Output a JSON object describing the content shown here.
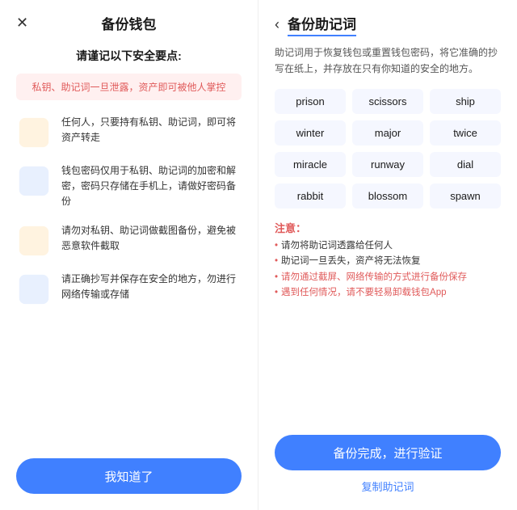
{
  "left": {
    "close_icon": "✕",
    "title": "备份钱包",
    "subtitle": "请谨记以下安全要点:",
    "warning": "私钥、助记词一旦泄露，资产即可被他人掌控",
    "tips": [
      {
        "text": "任何人，只要持有私钥、助记词，即可将资产转走"
      },
      {
        "text": "钱包密码仅用于私钥、助记词的加密和解密，密码只存储在手机上，请做好密码备份"
      },
      {
        "text": "请勿对私钥、助记词做截图备份，避免被恶意软件截取"
      },
      {
        "text": "请正确抄写并保存在安全的地方，勿进行网络传输或存储"
      }
    ],
    "button": "我知道了"
  },
  "right": {
    "back_icon": "‹",
    "title": "备份助记词",
    "description": "助记词用于恢复钱包或重置钱包密码，将它准确的抄写在纸上，并存放在只有你知道的安全的地方。",
    "words": [
      "prison",
      "scissors",
      "ship",
      "winter",
      "major",
      "twice",
      "miracle",
      "runway",
      "dial",
      "rabbit",
      "blossom",
      "spawn"
    ],
    "notice_title": "注意：",
    "notices": [
      {
        "text": "请勿将助记词透露给任何人",
        "highlight": false
      },
      {
        "text": "助记词一旦丢失，资产将无法恢复",
        "highlight": false
      },
      {
        "text": "请勿通过截屏、网络传输的方式进行备份保存",
        "highlight": true
      },
      {
        "text": "遇到任何情况，请不要轻易卸载钱包App",
        "highlight": true
      }
    ],
    "verify_button": "备份完成，进行验证",
    "copy_link": "复制助记词"
  }
}
